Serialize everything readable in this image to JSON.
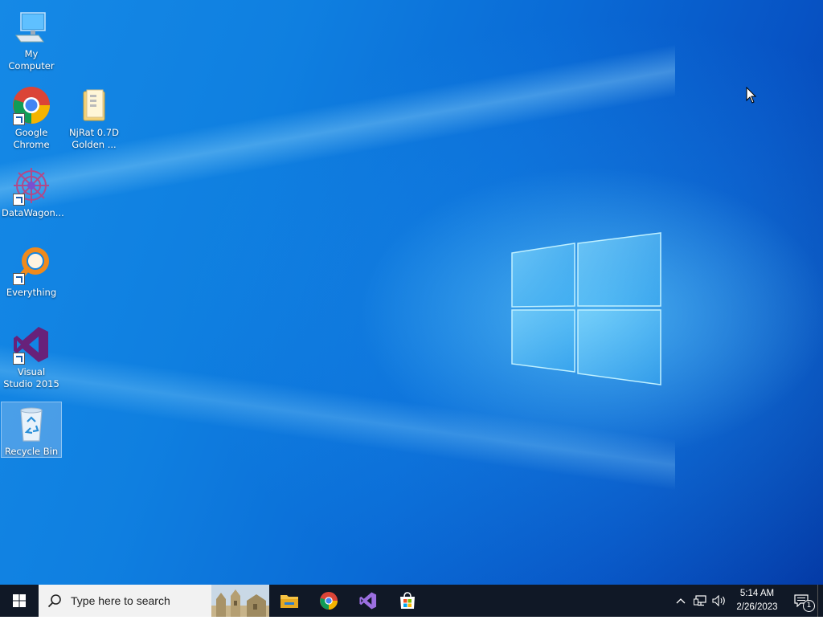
{
  "desktop": {
    "icons": [
      {
        "label": "My Computer"
      },
      {
        "label": "Google Chrome"
      },
      {
        "label": "NjRat 0.7D Golden ..."
      },
      {
        "label": "DataWagon..."
      },
      {
        "label": "Everything"
      },
      {
        "label": "Visual Studio 2015"
      },
      {
        "label": "Recycle Bin"
      }
    ]
  },
  "taskbar": {
    "search_placeholder": "Type here to search",
    "pinned_apps": [
      "file-explorer-icon",
      "chrome-icon",
      "visual-studio-icon",
      "microsoft-store-icon"
    ],
    "clock": {
      "time": "5:14 AM",
      "date": "2/26/2023"
    },
    "notification_count": "1"
  },
  "colors": {
    "taskbar": "#101826",
    "accent": "#0a6bd6"
  }
}
